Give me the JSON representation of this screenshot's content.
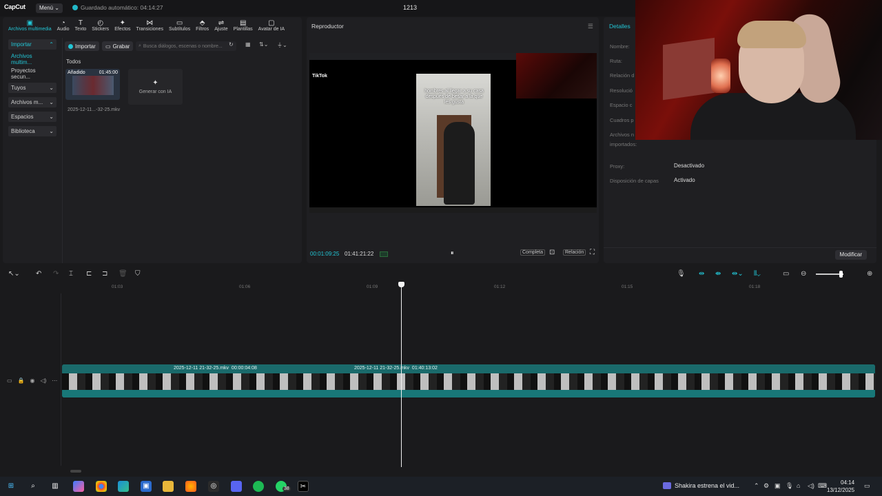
{
  "topbar": {
    "logo": "CapCut",
    "menu": "Menú ⌄",
    "autosave": "Guardado automático: 04:14:27",
    "project_title": "1213"
  },
  "tools": [
    {
      "label": "Archivos multimedia",
      "icon": "media-icon",
      "glyph": "▣",
      "active": true
    },
    {
      "label": "Audio",
      "icon": "audio-icon",
      "glyph": "◔",
      "active": false
    },
    {
      "label": "Texto",
      "icon": "text-icon",
      "glyph": "T",
      "active": false
    },
    {
      "label": "Stickers",
      "icon": "sticker-icon",
      "glyph": "◴",
      "active": false
    },
    {
      "label": "Efectos",
      "icon": "effects-icon",
      "glyph": "✦",
      "active": false
    },
    {
      "label": "Transiciones",
      "icon": "transition-icon",
      "glyph": "⋈",
      "active": false
    },
    {
      "label": "Subtítulos",
      "icon": "subtitles-icon",
      "glyph": "▭",
      "active": false
    },
    {
      "label": "Filtros",
      "icon": "filter-icon",
      "glyph": "⬘",
      "active": false
    },
    {
      "label": "Ajuste",
      "icon": "adjust-icon",
      "glyph": "⇌",
      "active": false
    },
    {
      "label": "Plantillas",
      "icon": "templates-icon",
      "glyph": "▤",
      "active": false
    },
    {
      "label": "Avatar de IA",
      "icon": "avatar-icon",
      "glyph": "▢",
      "active": false
    }
  ],
  "sidebar": {
    "items": [
      {
        "label": "Importar",
        "chev": "⌃"
      },
      {
        "label": "Archivos multim...",
        "chev": ""
      },
      {
        "label": "Proyectos secun...",
        "chev": ""
      },
      {
        "label": "Tuyos",
        "chev": "⌄"
      },
      {
        "label": "Archivos m...",
        "chev": "⌄"
      },
      {
        "label": "Espacios",
        "chev": "⌄"
      },
      {
        "label": "Biblioteca",
        "chev": "⌄"
      }
    ]
  },
  "media": {
    "import_btn": "Importar",
    "record_btn": "Grabar",
    "search_placeholder": "Busca diálogos, escenas o nombre...",
    "section": "Todos",
    "clip_badge": "Añadido",
    "clip_duration": "01:45:00",
    "clip_name": "2025-12-11...-32-25.mkv",
    "generate_label": "Generar con IA"
  },
  "player": {
    "title": "Reproductor",
    "screen_caption": "hombres al llegar a su casa después de besar a la que les gusta",
    "screen_app": "TikTok",
    "current_time": "00:01:09:25",
    "total_time": "01:41:21:22",
    "full_btn": "Completa",
    "ratio_btn": "Relación"
  },
  "details": {
    "title": "Detalles",
    "labels": [
      "Nombre:",
      "Ruta:",
      "Relación d",
      "Resolució",
      "Espacio c",
      "Cuadros p",
      "Archivos n",
      "importados:"
    ],
    "proxy_label": "Proxy:",
    "proxy_value": "Desactivado",
    "layers_label": "Disposición de capas",
    "layers_value": "Activado",
    "modify_btn": "Modificar"
  },
  "timeline": {
    "ticks": [
      "01:03",
      "01:06",
      "01:09",
      "01:12",
      "01:15",
      "01:18"
    ],
    "clip1_name": "2025-12-11 21-32-25.mkv",
    "clip1_dur": "00:00:04:08",
    "clip2_name": "2025-12-11 21-32-25.mkv",
    "clip2_dur": "01:40:13:02"
  },
  "taskbar": {
    "news": "Shakira estrena el vid...",
    "time": "04:14",
    "date": "13/12/2025",
    "badge": "38"
  },
  "colors": {
    "accent": "#22c6d6",
    "track": "#1f7f80",
    "panel": "#1f1f22"
  }
}
